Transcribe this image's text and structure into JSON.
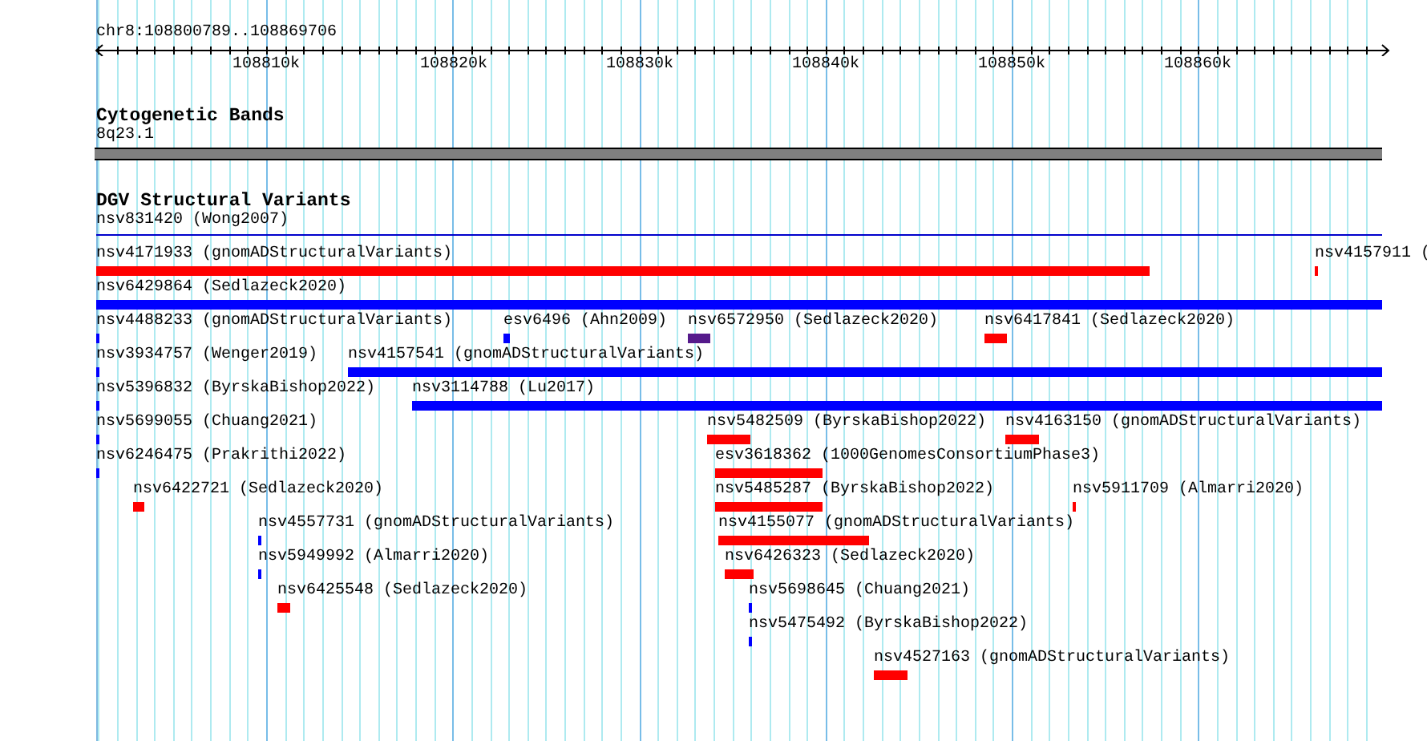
{
  "ruler": {
    "region": "chr8:108800789..108869706",
    "ticks": [
      "108810k",
      "108820k",
      "108830k",
      "108840k",
      "108850k",
      "108860k"
    ]
  },
  "tracks": [
    {
      "title": "Cytogenetic Bands",
      "kind": "bands",
      "bands": [
        {
          "label": "8q23.1",
          "color": "#808080"
        }
      ]
    },
    {
      "title": "DGV Structural Variants",
      "kind": "variants",
      "features": [
        {
          "label": "nsv831420 (Wong2007)",
          "kind": "line",
          "color": "#0000cc"
        },
        {
          "label": "nsv4171933 (gnomADStructuralVariants)",
          "kind": "bar",
          "color": "#ff0000"
        },
        {
          "label": "nsv4157911 (",
          "kind": "bar",
          "color": "#ff0000"
        },
        {
          "label": "nsv6429864 (Sedlazeck2020)",
          "kind": "bar",
          "color": "#0000ff"
        },
        {
          "label": "nsv4488233 (gnomADStructuralVariants)",
          "kind": "bar",
          "color": "#0000ff"
        },
        {
          "label": "esv6496 (Ahn2009)",
          "kind": "bar",
          "color": "#0000ff"
        },
        {
          "label": "nsv6572950 (Sedlazeck2020)",
          "kind": "bar",
          "color": "#551a8b"
        },
        {
          "label": "nsv6417841 (Sedlazeck2020)",
          "kind": "bar",
          "color": "#ff0000"
        },
        {
          "label": "nsv3934757 (Wenger2019)",
          "kind": "bar",
          "color": "#0000ff"
        },
        {
          "label": "nsv4157541 (gnomADStructuralVariants)",
          "kind": "bar",
          "color": "#0000ff"
        },
        {
          "label": "nsv5396832 (ByrskaBishop2022)",
          "kind": "bar",
          "color": "#0000ff"
        },
        {
          "label": "nsv3114788 (Lu2017)",
          "kind": "bar",
          "color": "#0000ff"
        },
        {
          "label": "nsv5699055 (Chuang2021)",
          "kind": "bar",
          "color": "#0000ff"
        },
        {
          "label": "nsv5482509 (ByrskaBishop2022)",
          "kind": "bar",
          "color": "#ff0000"
        },
        {
          "label": "nsv4163150 (gnomADStructuralVariants)",
          "kind": "bar",
          "color": "#ff0000"
        },
        {
          "label": "nsv6246475 (Prakrithi2022)",
          "kind": "bar",
          "color": "#0000ff"
        },
        {
          "label": "esv3618362 (1000GenomesConsortiumPhase3)",
          "kind": "bar",
          "color": "#ff0000"
        },
        {
          "label": "nsv6422721 (Sedlazeck2020)",
          "kind": "bar",
          "color": "#ff0000"
        },
        {
          "label": "nsv5485287 (ByrskaBishop2022)",
          "kind": "bar",
          "color": "#ff0000"
        },
        {
          "label": "nsv5911709 (Almarri2020)",
          "kind": "bar",
          "color": "#ff0000"
        },
        {
          "label": "nsv4557731 (gnomADStructuralVariants)",
          "kind": "bar",
          "color": "#0000ff"
        },
        {
          "label": "nsv4155077 (gnomADStructuralVariants)",
          "kind": "bar",
          "color": "#ff0000"
        },
        {
          "label": "nsv5949992 (Almarri2020)",
          "kind": "bar",
          "color": "#0000ff"
        },
        {
          "label": "nsv6426323 (Sedlazeck2020)",
          "kind": "bar",
          "color": "#ff0000"
        },
        {
          "label": "nsv6425548 (Sedlazeck2020)",
          "kind": "bar",
          "color": "#ff0000"
        },
        {
          "label": "nsv5698645 (Chuang2021)",
          "kind": "bar",
          "color": "#0000ff"
        },
        {
          "label": "nsv5475492 (ByrskaBishop2022)",
          "kind": "bar",
          "color": "#0000ff"
        },
        {
          "label": "nsv4527163 (gnomADStructuralVariants)",
          "kind": "bar",
          "color": "#ff0000"
        }
      ]
    }
  ]
}
